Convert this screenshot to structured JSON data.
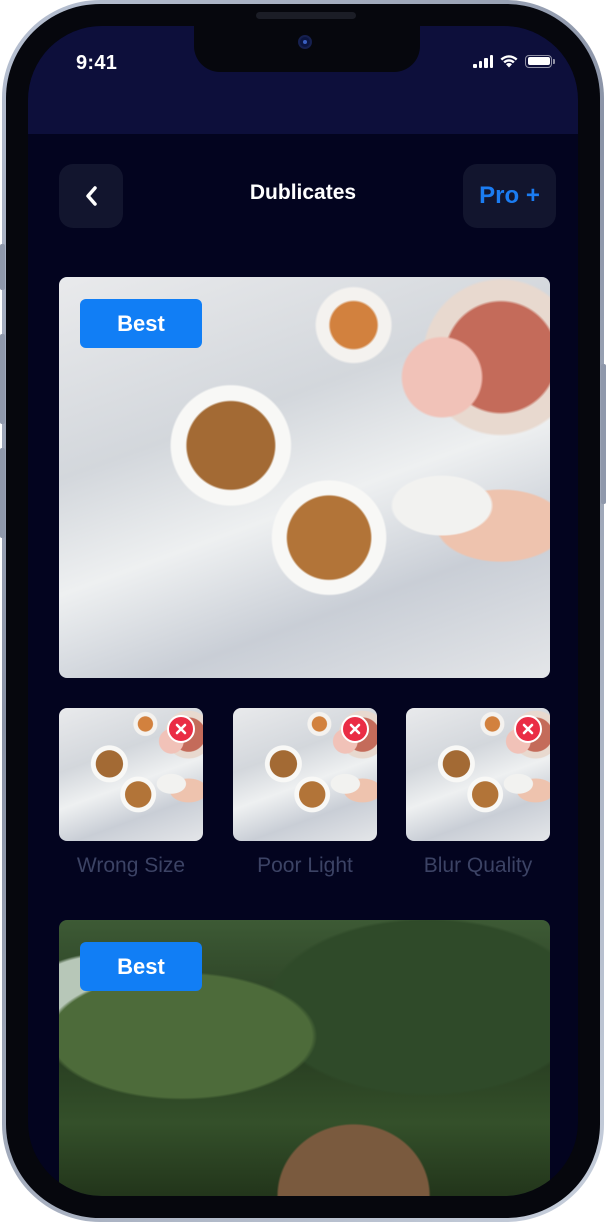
{
  "status_bar": {
    "time": "9:41",
    "icons": [
      "cellular-signal-icon",
      "wifi-icon",
      "battery-icon"
    ]
  },
  "header": {
    "back_icon": "chevron-left-icon",
    "title": "Dublicates",
    "pro_label": "Pro +"
  },
  "groups": [
    {
      "best_label": "Best",
      "image": "breakfast-photo",
      "duplicates": [
        {
          "label": "Wrong Size",
          "icon": "reject-x-icon"
        },
        {
          "label": "Poor Light",
          "icon": "reject-x-icon"
        },
        {
          "label": "Blur Quality",
          "icon": "reject-x-icon"
        }
      ]
    },
    {
      "best_label": "Best",
      "image": "forest-photo"
    }
  ],
  "colors": {
    "background": "#03041f",
    "accent": "#117ef5",
    "reject": "#ea2d45"
  }
}
